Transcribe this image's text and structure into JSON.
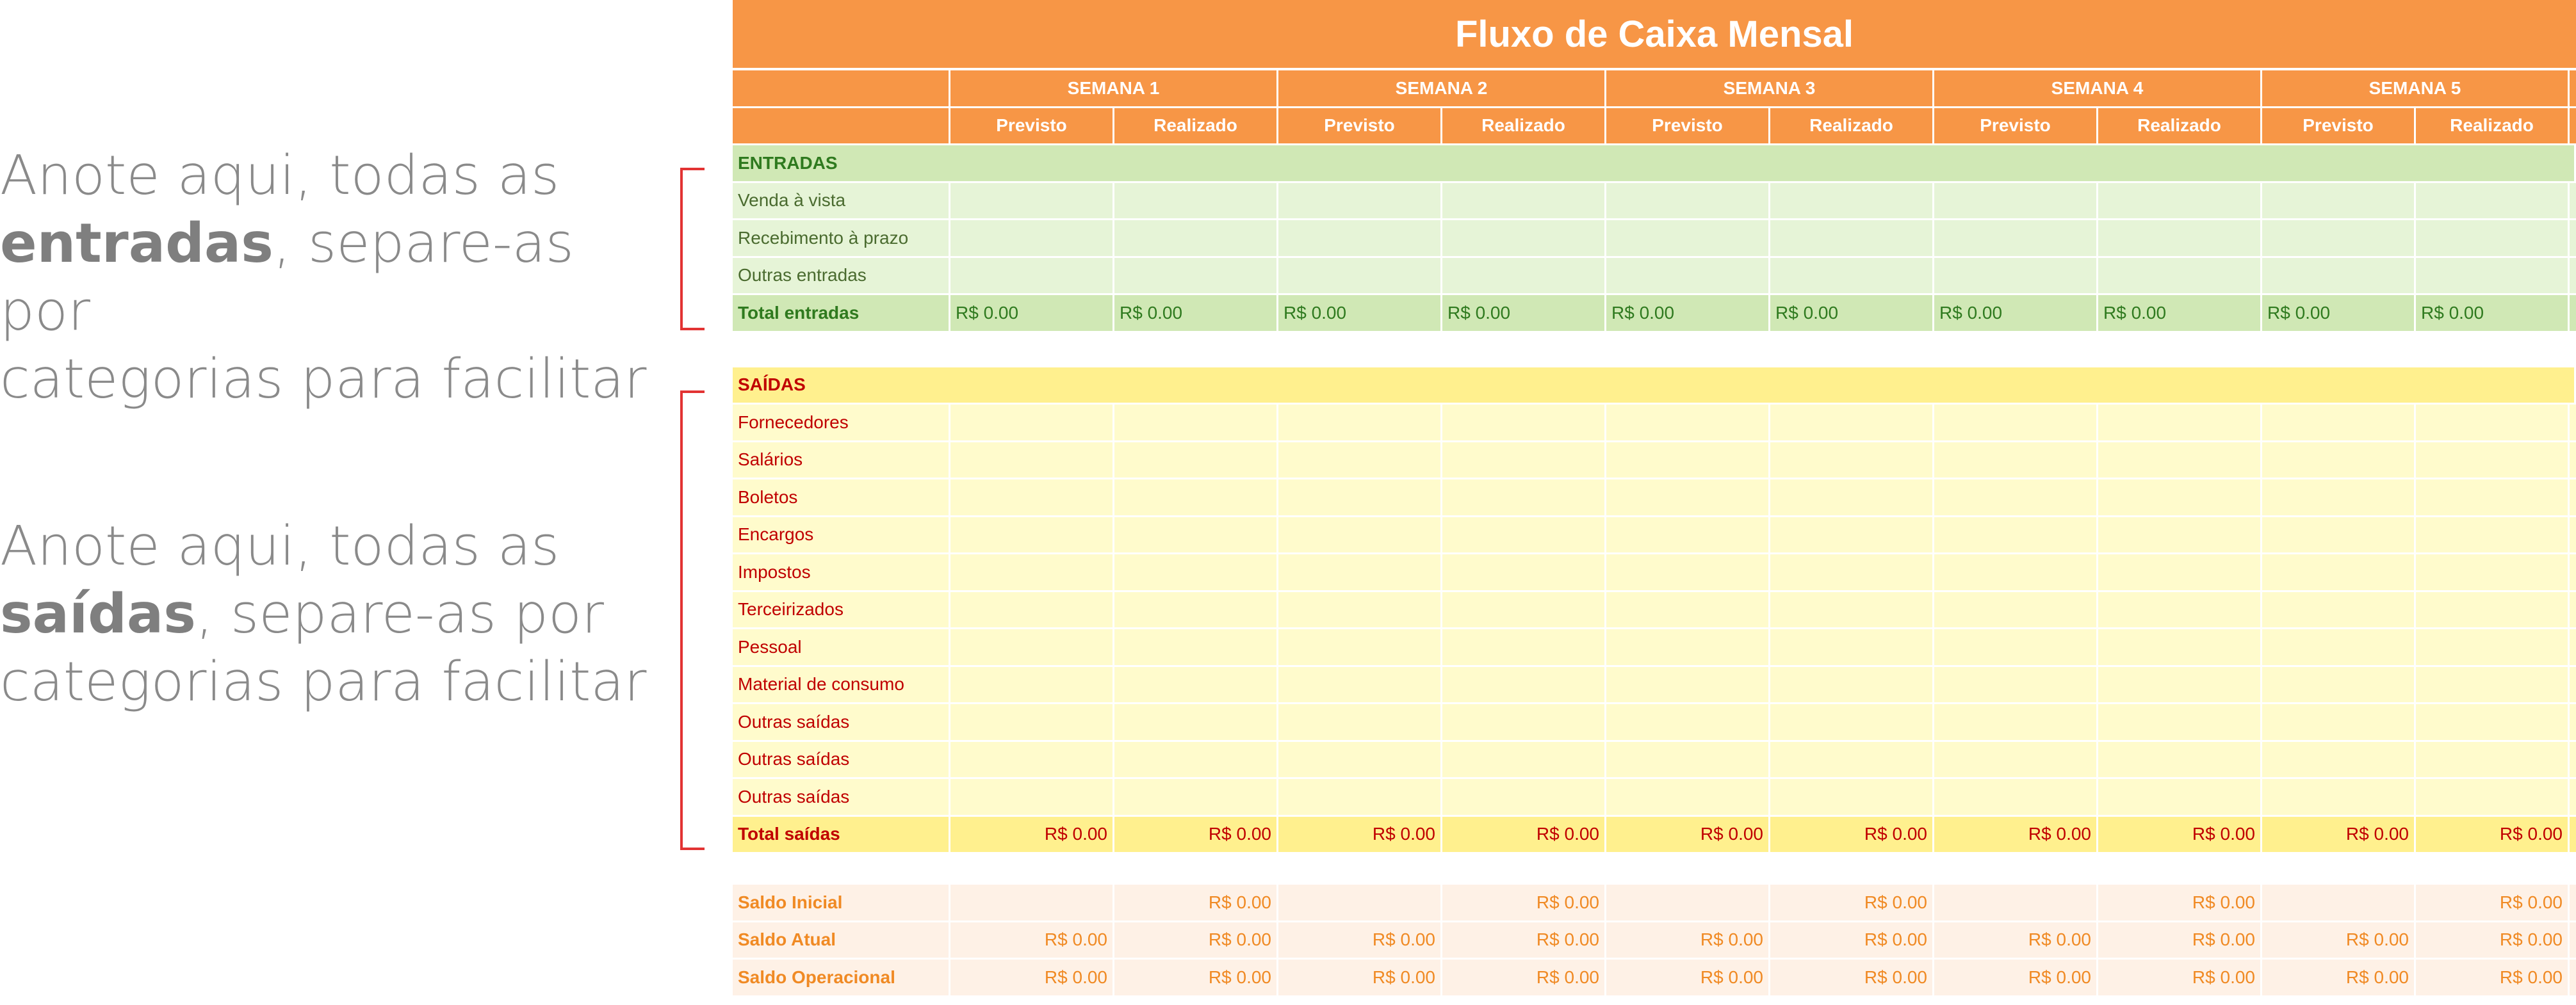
{
  "annotations": {
    "entradas": {
      "line1": "Anote aqui, todas as",
      "bold": "entradas",
      "rest": ", separe-as por",
      "line3": "categorias para facilitar"
    },
    "saidas": {
      "line1": "Anote aqui, todas as",
      "bold": "saídas",
      "rest": ", separe-as por",
      "line3": "categorias para facilitar"
    }
  },
  "sheet": {
    "title": "Fluxo de Caixa Mensal",
    "weeks": [
      "SEMANA 1",
      "SEMANA 2",
      "SEMANA 3",
      "SEMANA 4",
      "SEMANA 5"
    ],
    "sub_previsto": "Previsto",
    "sub_realizado": "Realizado",
    "entradas": {
      "header": "ENTRADAS",
      "items": [
        "Venda à vista",
        "Recebimento à prazo",
        "Outras entradas"
      ],
      "total_label": "Total entradas",
      "totals": [
        "R$ 0.00",
        "R$ 0.00",
        "R$ 0.00",
        "R$ 0.00",
        "R$ 0.00",
        "R$ 0.00",
        "R$ 0.00",
        "R$ 0.00",
        "R$ 0.00",
        "R$ 0.00"
      ]
    },
    "saidas": {
      "header": "SAÍDAS",
      "items": [
        "Fornecedores",
        "Salários",
        "Boletos",
        "Encargos",
        "Impostos",
        "Terceirizados",
        "Pessoal",
        "Material de consumo",
        "Outras saídas",
        "Outras saídas",
        "Outras saídas"
      ],
      "total_label": "Total saídas",
      "totals": [
        "R$ 0.00",
        "R$ 0.00",
        "R$ 0.00",
        "R$ 0.00",
        "R$ 0.00",
        "R$ 0.00",
        "R$ 0.00",
        "R$ 0.00",
        "R$ 0.00",
        "R$ 0.00"
      ]
    },
    "saldos": [
      {
        "label": "Saldo Inicial",
        "values": [
          "",
          "R$ 0.00",
          "",
          "R$ 0.00",
          "",
          "R$ 0.00",
          "",
          "R$ 0.00",
          "",
          "R$ 0.00"
        ]
      },
      {
        "label": "Saldo Atual",
        "values": [
          "R$ 0.00",
          "R$ 0.00",
          "R$ 0.00",
          "R$ 0.00",
          "R$ 0.00",
          "R$ 0.00",
          "R$ 0.00",
          "R$ 0.00",
          "R$ 0.00",
          "R$ 0.00"
        ]
      },
      {
        "label": "Saldo Operacional",
        "values": [
          "R$ 0.00",
          "R$ 0.00",
          "R$ 0.00",
          "R$ 0.00",
          "R$ 0.00",
          "R$ 0.00",
          "R$ 0.00",
          "R$ 0.00",
          "R$ 0.00",
          "R$ 0.00"
        ]
      }
    ]
  },
  "colors": {
    "header_orange": "#f79646",
    "entradas_green": "#d0e8b5",
    "saidas_yellow": "#fff08e",
    "saidas_text_red": "#c00000",
    "saldo_text_orange": "#f08a24",
    "bracket_red": "#e23333"
  }
}
